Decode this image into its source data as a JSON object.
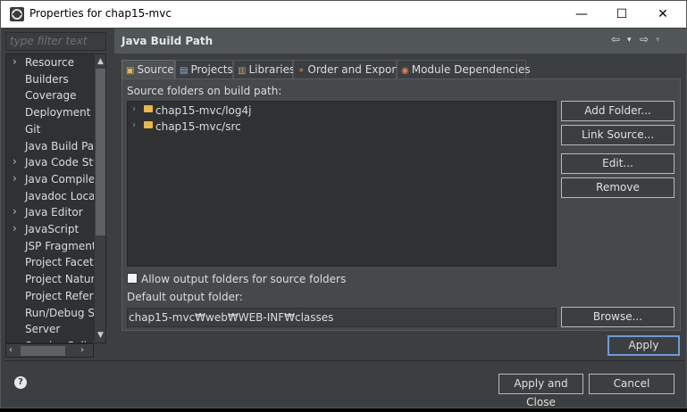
{
  "window": {
    "title": "Properties for chap15-mvc",
    "min": "—",
    "max": "☐",
    "close": "✕"
  },
  "filter": {
    "placeholder": "type filter text"
  },
  "nav": {
    "items": [
      {
        "label": "Resource",
        "arrow": "›"
      },
      {
        "label": "Builders",
        "arrow": ""
      },
      {
        "label": "Coverage",
        "arrow": ""
      },
      {
        "label": "Deployment Assembly",
        "arrow": ""
      },
      {
        "label": "Git",
        "arrow": ""
      },
      {
        "label": "Java Build Path",
        "arrow": ""
      },
      {
        "label": "Java Code Style",
        "arrow": "›"
      },
      {
        "label": "Java Compiler",
        "arrow": "›"
      },
      {
        "label": "Javadoc Location",
        "arrow": ""
      },
      {
        "label": "Java Editor",
        "arrow": "›"
      },
      {
        "label": "JavaScript",
        "arrow": "›"
      },
      {
        "label": "JSP Fragment",
        "arrow": ""
      },
      {
        "label": "Project Facets",
        "arrow": ""
      },
      {
        "label": "Project Natures",
        "arrow": ""
      },
      {
        "label": "Project References",
        "arrow": ""
      },
      {
        "label": "Run/Debug Settings",
        "arrow": ""
      },
      {
        "label": "Server",
        "arrow": ""
      },
      {
        "label": "Service Policies",
        "arrow": ""
      }
    ]
  },
  "page": {
    "title": "Java Build Path",
    "nav_back": "⇦",
    "nav_back_menu": "▾",
    "nav_forward": "⇨",
    "nav_forward_menu": "▾"
  },
  "tabs": [
    {
      "label": "Source",
      "icon": "▣"
    },
    {
      "label": "Projects",
      "icon": "▤"
    },
    {
      "label": "Libraries",
      "icon": "▥"
    },
    {
      "label": "Order and Export",
      "icon": "⚬"
    },
    {
      "label": "Module Dependencies",
      "icon": "◉"
    }
  ],
  "source": {
    "folders_label": "Source folders on build path:",
    "folders": [
      {
        "name": "chap15-mvc/log4j"
      },
      {
        "name": "chap15-mvc/src"
      }
    ],
    "allow_output_label": "Allow output folders for source folders",
    "default_output_label": "Default output folder:",
    "default_output_value": "chap15-mvc₩web₩WEB-INF₩classes"
  },
  "buttons": {
    "add_folder": "Add Folder...",
    "link_source": "Link Source...",
    "edit": "Edit...",
    "remove": "Remove",
    "browse": "Browse...",
    "apply": "Apply",
    "apply_close": "Apply and Close",
    "cancel": "Cancel",
    "help": "?"
  }
}
